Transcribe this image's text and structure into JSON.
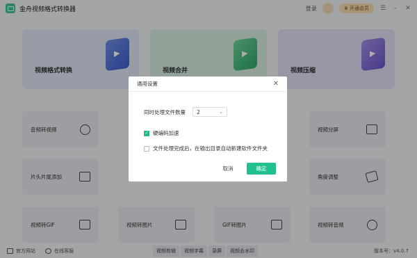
{
  "app": {
    "title": "金舟视频格式转换器"
  },
  "topbar": {
    "login": "登录",
    "vip": "开通会员"
  },
  "big_cards": [
    {
      "label": "视频格式转换"
    },
    {
      "label": "视频合并"
    },
    {
      "label": "视频压缩"
    }
  ],
  "tools": [
    {
      "label": "音频转视频",
      "icon": "disc-icon"
    },
    {
      "label": "视频分屏",
      "icon": "split-screen-icon"
    },
    {
      "label": "片头片尾添加",
      "icon": "film-icon"
    },
    {
      "label": "角度调整",
      "icon": "rotate-icon"
    },
    {
      "label": "视频转GIF",
      "icon": "gif-icon"
    },
    {
      "label": "视频转图片",
      "icon": "image-icon"
    },
    {
      "label": "GIF转图片",
      "icon": "gif-image-icon"
    },
    {
      "label": "视频转音频",
      "icon": "music-icon"
    }
  ],
  "bottom": {
    "website": "官方网站",
    "support": "在线客服",
    "chips": [
      "视频剪辑",
      "视频字幕",
      "录屏",
      "视频去水印"
    ],
    "version": "版本号：v4.0.7"
  },
  "dialog": {
    "title": "通用设置",
    "count_label": "同时处理文件数量",
    "count_value": "2",
    "hw_accel": "硬编码加速",
    "auto_folder": "文件处理完成后，在输出目录自动新建软件文件夹",
    "cancel": "取消",
    "ok": "确定"
  },
  "colors": {
    "accent": "#23bf8e",
    "vip": "#f6dcb0"
  }
}
